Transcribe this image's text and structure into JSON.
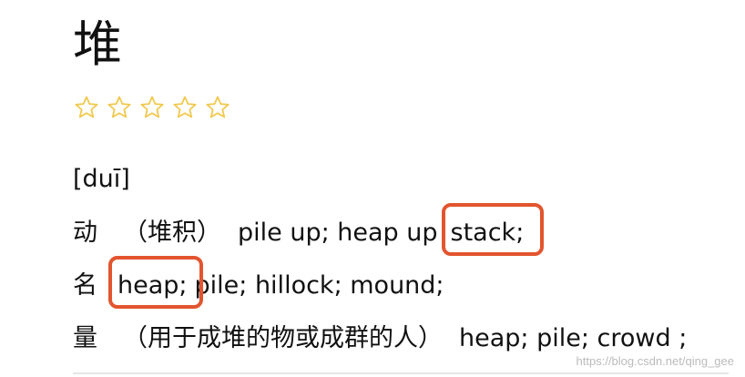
{
  "entry": {
    "headword": "堆",
    "rating": {
      "stars_total": 5,
      "stars_filled": 0,
      "star_color": "#f1c84b"
    },
    "pinyin": "[duī]",
    "definitions": [
      {
        "pos": "动",
        "note": "（堆积）",
        "before": "pile up; heap up",
        "highlight": "stack;",
        "after": ""
      },
      {
        "pos": "名",
        "note": "",
        "before": "",
        "highlight": "heap;",
        "after": "pile; hillock; mound;"
      },
      {
        "pos": "量",
        "note": "（用于成堆的物或成群的人）",
        "before": "heap; pile; crowd ;",
        "highlight": "",
        "after": ""
      }
    ],
    "highlight_color": "#e2552f"
  },
  "watermark": "https://blog.csdn.net/qing_gee"
}
